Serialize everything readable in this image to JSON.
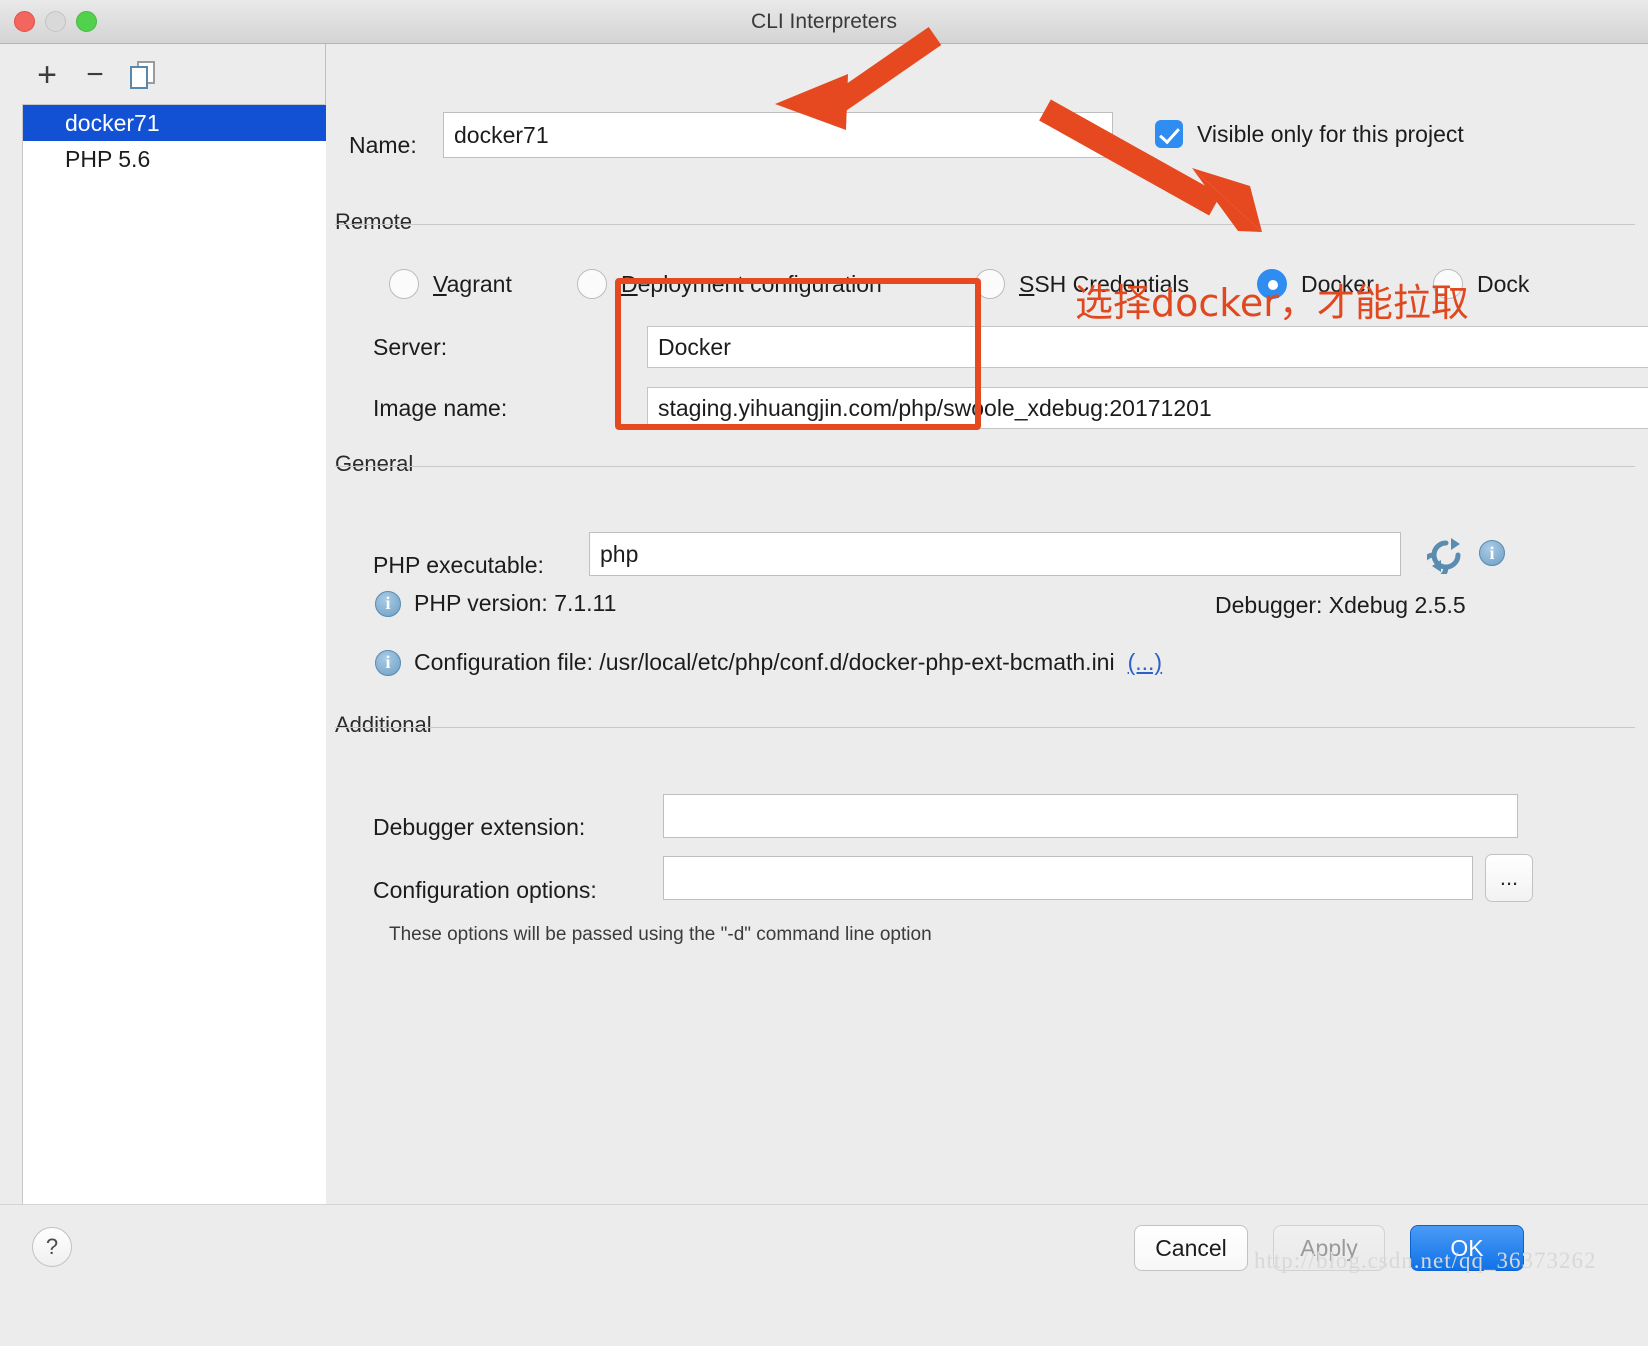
{
  "window": {
    "title": "CLI Interpreters",
    "traffic_lights": [
      "close",
      "minimize",
      "zoom"
    ]
  },
  "sidebar": {
    "toolbar": {
      "add_label": "+",
      "remove_label": "−",
      "copy_label": "copy-icon"
    },
    "items": [
      {
        "label": "docker71",
        "selected": true
      },
      {
        "label": "PHP 5.6",
        "selected": false
      }
    ]
  },
  "form": {
    "name_label": "Name:",
    "name_value": "docker71",
    "visible_only_label": "Visible only for this project",
    "visible_only_checked": true,
    "remote": {
      "group_title": "Remote",
      "options": [
        {
          "label": "Vagrant",
          "mnemonic": "V",
          "selected": false
        },
        {
          "label": "Deployment configuration",
          "mnemonic": "D",
          "selected": false
        },
        {
          "label": "SSH Credentials",
          "mnemonic": "S",
          "selected": false
        },
        {
          "label": "Docker",
          "mnemonic": "",
          "selected": true
        },
        {
          "label": "Dock",
          "mnemonic": "",
          "selected": false
        }
      ],
      "server_label": "Server:",
      "server_value": "Docker",
      "image_label": "Image name:",
      "image_value": "staging.yihuangjin.com/php/swoole_xdebug:20171201"
    },
    "general": {
      "group_title": "General",
      "php_executable_label": "PHP executable:",
      "php_executable_value": "php",
      "refresh_icon": "refresh-icon",
      "info_icon": "info-icon",
      "php_version_text": "PHP version: 7.1.11",
      "debugger_text": "Debugger: Xdebug 2.5.5",
      "configuration_file_text": "Configuration file: /usr/local/etc/php/conf.d/docker-php-ext-bcmath.ini",
      "configuration_file_link": "(...)"
    },
    "additional": {
      "group_title": "Additional",
      "debugger_extension_label": "Debugger extension:",
      "debugger_extension_value": "",
      "configuration_options_label": "Configuration options:",
      "configuration_options_value": "",
      "browse_label": "...",
      "hint": "These options will be passed using the \"-d\" command line option"
    }
  },
  "footer": {
    "help_label": "?",
    "cancel_label": "Cancel",
    "apply_label": "Apply",
    "ok_label": "OK"
  },
  "annotations": {
    "callout_text": "选择docker，才能拉取",
    "highlight_color": "#e6491f",
    "arrow_color": "#e6491f"
  },
  "watermark": {
    "text": "http://blog.csdn.net/qq_36373262"
  }
}
